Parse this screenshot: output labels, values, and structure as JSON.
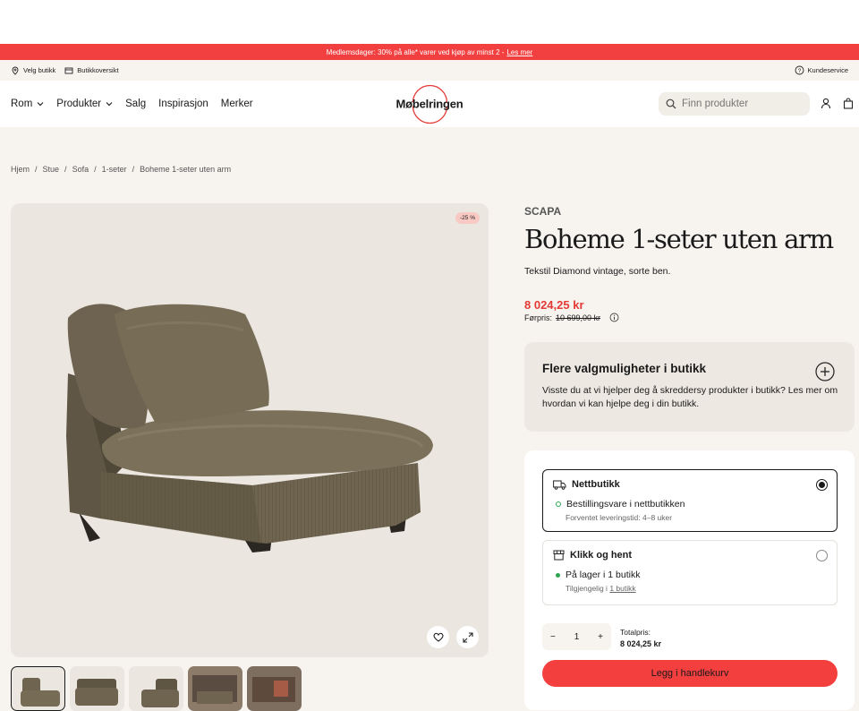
{
  "promo": {
    "text": "Medlemsdager: 30% på alle* varer ved kjøp av minst 2 -",
    "link": "Les mer"
  },
  "util": {
    "store": "Velg butikk",
    "overview": "Butikkoversikt",
    "service": "Kundeservice"
  },
  "nav": {
    "items": [
      "Rom",
      "Produkter",
      "Salg",
      "Inspirasjon",
      "Merker"
    ],
    "logo": "Møbelringen"
  },
  "search": {
    "placeholder": "Finn produkter"
  },
  "breadcrumb": [
    "Hjem",
    "/",
    "Stue",
    "/",
    "Sofa",
    "/",
    "1-seter",
    "/",
    "Boheme 1-seter uten arm"
  ],
  "gallery": {
    "badge": "-25 %"
  },
  "product": {
    "brand": "SCAPA",
    "title": "Boheme 1-seter uten arm",
    "description": "Tekstil Diamond vintage, sorte ben.",
    "price": "8 024,25 kr",
    "before_label": "Førpris:",
    "before_price": "10 699,00 kr"
  },
  "more_options": {
    "title": "Flere valgmuligheter i butikk",
    "text": "Visste du at vi hjelper deg å skreddersy produkter i butikk? Les mer om hvordan vi kan hjelpe deg i din butikk."
  },
  "delivery": {
    "online": {
      "title": "Nettbutikk",
      "status": "Bestillingsvare i nettbutikken",
      "sub": "Forventet leveringstid: 4–8 uker",
      "selected": true
    },
    "pickup": {
      "title": "Klikk og hent",
      "status": "På lager i 1 butikk",
      "sub": "Tilgjengelig i",
      "sub_link": "1 butikk",
      "selected": false
    }
  },
  "quantity": {
    "minus": "−",
    "value": "1",
    "plus": "+"
  },
  "total": {
    "label": "Totalpris:",
    "value": "8 024,25 kr"
  },
  "cart_button": "Legg i handlekurv",
  "colors": {
    "accent": "#f24040",
    "price": "#e53935",
    "stock": "#2ea44f"
  }
}
